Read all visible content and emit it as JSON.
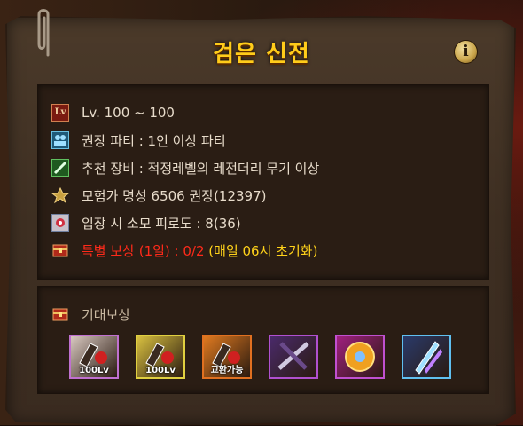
{
  "dungeon": {
    "title": "검은 신전",
    "info_label": "i"
  },
  "requirements": [
    {
      "icon": "level-icon",
      "icon_text": "Lv",
      "parts": [
        {
          "text": "Lv. 100 ~ 100",
          "style": "normal"
        }
      ]
    },
    {
      "icon": "party-icon",
      "parts": [
        {
          "text": "권장 파티 : 1인 이상 파티",
          "style": "normal"
        }
      ]
    },
    {
      "icon": "sword-icon",
      "parts": [
        {
          "text": "추천 장비 : 적정레벨의 레전더리 무기 이상",
          "style": "normal"
        }
      ]
    },
    {
      "icon": "reputation-icon",
      "parts": [
        {
          "text": "모험가 명성 6506 권장(12397)",
          "style": "normal"
        }
      ]
    },
    {
      "icon": "fatigue-icon",
      "parts": [
        {
          "text": "입장 시 소모 피로도 : 8(36)",
          "style": "normal"
        }
      ]
    },
    {
      "icon": "reward-chest-icon",
      "parts": [
        {
          "text": "특별 보상 (1일) : 0/2 ",
          "style": "red"
        },
        {
          "text": "(매일 06시 초기화)",
          "style": "yellow"
        }
      ]
    }
  ],
  "expected_rewards": {
    "label": "기대보상",
    "items": [
      {
        "name": "equipment-box-icon",
        "badge": "100Lv",
        "frame": "#c070d0",
        "bg": "#d8c8c0"
      },
      {
        "name": "equipment-box-icon",
        "badge": "100Lv",
        "frame": "#e0d040",
        "bg": "#d8c040"
      },
      {
        "name": "equipment-box-icon",
        "badge": "교환가능",
        "frame": "#e07020",
        "bg": "#e07a20"
      },
      {
        "name": "crossed-blades-icon",
        "badge": "",
        "frame": "#b050d0",
        "bg": "#4a2a6a"
      },
      {
        "name": "golden-orb-icon",
        "badge": "",
        "frame": "#c050d0",
        "bg": "#a02080"
      },
      {
        "name": "crystal-shard-icon",
        "badge": "",
        "frame": "#60c0f0",
        "bg": "#2a3a6a"
      }
    ]
  }
}
